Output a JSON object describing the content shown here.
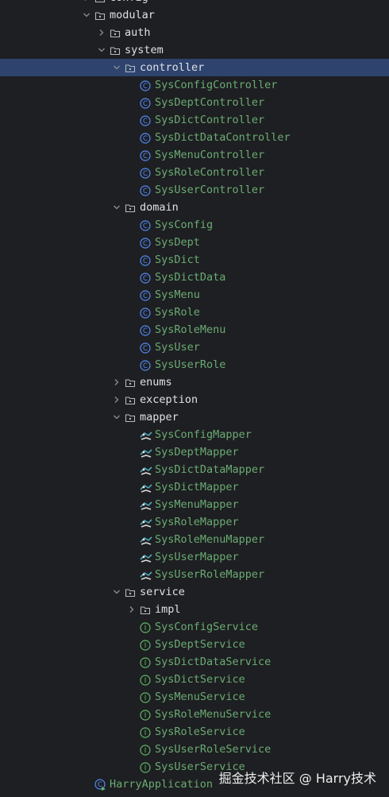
{
  "tree": [
    {
      "label": "config",
      "kind": "package",
      "depth": 0,
      "state": "collapsed"
    },
    {
      "label": "modular",
      "kind": "package",
      "depth": 0,
      "state": "expanded"
    },
    {
      "label": "auth",
      "kind": "package",
      "depth": 1,
      "state": "collapsed"
    },
    {
      "label": "system",
      "kind": "package",
      "depth": 1,
      "state": "expanded"
    },
    {
      "label": "controller",
      "kind": "package",
      "depth": 2,
      "state": "expanded",
      "selected": true
    },
    {
      "label": "SysConfigController",
      "kind": "class",
      "depth": 3
    },
    {
      "label": "SysDeptController",
      "kind": "class",
      "depth": 3
    },
    {
      "label": "SysDictController",
      "kind": "class",
      "depth": 3
    },
    {
      "label": "SysDictDataController",
      "kind": "class",
      "depth": 3
    },
    {
      "label": "SysMenuController",
      "kind": "class",
      "depth": 3
    },
    {
      "label": "SysRoleController",
      "kind": "class",
      "depth": 3
    },
    {
      "label": "SysUserController",
      "kind": "class",
      "depth": 3
    },
    {
      "label": "domain",
      "kind": "package",
      "depth": 2,
      "state": "expanded"
    },
    {
      "label": "SysConfig",
      "kind": "class",
      "depth": 3
    },
    {
      "label": "SysDept",
      "kind": "class",
      "depth": 3
    },
    {
      "label": "SysDict",
      "kind": "class",
      "depth": 3
    },
    {
      "label": "SysDictData",
      "kind": "class",
      "depth": 3
    },
    {
      "label": "SysMenu",
      "kind": "class",
      "depth": 3
    },
    {
      "label": "SysRole",
      "kind": "class",
      "depth": 3
    },
    {
      "label": "SysRoleMenu",
      "kind": "class",
      "depth": 3
    },
    {
      "label": "SysUser",
      "kind": "class",
      "depth": 3
    },
    {
      "label": "SysUserRole",
      "kind": "class",
      "depth": 3
    },
    {
      "label": "enums",
      "kind": "package",
      "depth": 2,
      "state": "collapsed"
    },
    {
      "label": "exception",
      "kind": "package",
      "depth": 2,
      "state": "collapsed"
    },
    {
      "label": "mapper",
      "kind": "package",
      "depth": 2,
      "state": "expanded"
    },
    {
      "label": "SysConfigMapper",
      "kind": "mapper",
      "depth": 3
    },
    {
      "label": "SysDeptMapper",
      "kind": "mapper",
      "depth": 3
    },
    {
      "label": "SysDictDataMapper",
      "kind": "mapper",
      "depth": 3
    },
    {
      "label": "SysDictMapper",
      "kind": "mapper",
      "depth": 3
    },
    {
      "label": "SysMenuMapper",
      "kind": "mapper",
      "depth": 3
    },
    {
      "label": "SysRoleMapper",
      "kind": "mapper",
      "depth": 3
    },
    {
      "label": "SysRoleMenuMapper",
      "kind": "mapper",
      "depth": 3
    },
    {
      "label": "SysUserMapper",
      "kind": "mapper",
      "depth": 3
    },
    {
      "label": "SysUserRoleMapper",
      "kind": "mapper",
      "depth": 3
    },
    {
      "label": "service",
      "kind": "package",
      "depth": 2,
      "state": "expanded"
    },
    {
      "label": "impl",
      "kind": "package",
      "depth": 3,
      "state": "collapsed"
    },
    {
      "label": "SysConfigService",
      "kind": "interface",
      "depth": 3
    },
    {
      "label": "SysDeptService",
      "kind": "interface",
      "depth": 3
    },
    {
      "label": "SysDictDataService",
      "kind": "interface",
      "depth": 3
    },
    {
      "label": "SysDictService",
      "kind": "interface",
      "depth": 3
    },
    {
      "label": "SysMenuService",
      "kind": "interface",
      "depth": 3
    },
    {
      "label": "SysRoleMenuService",
      "kind": "interface",
      "depth": 3
    },
    {
      "label": "SysRoleService",
      "kind": "interface",
      "depth": 3
    },
    {
      "label": "SysUserRoleService",
      "kind": "interface",
      "depth": 3
    },
    {
      "label": "SysUserService",
      "kind": "interface",
      "depth": 3
    },
    {
      "label": "HarryApplication",
      "kind": "app",
      "depth": 0
    }
  ],
  "watermark": "掘金技术社区 @ Harry技术",
  "colors": {
    "background": "#1e1f22",
    "selection": "#2e436e",
    "folder_text": "#dfe1e5",
    "class_text": "#6aab73",
    "class_icon": "#548af7",
    "interface_icon": "#5fb865",
    "chevron": "#8c8f94"
  }
}
